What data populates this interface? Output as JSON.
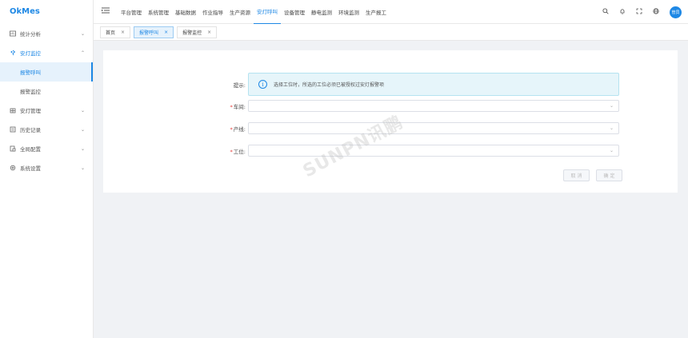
{
  "app": {
    "logo": "OkMes"
  },
  "sidebar": {
    "items": [
      {
        "label": "统计分析",
        "icon": "chart-icon",
        "chev": "⌄"
      },
      {
        "label": "安灯监控",
        "icon": "monitor-icon",
        "chev": "⌃",
        "open": true,
        "children": [
          {
            "label": "报警呼叫",
            "active": true
          },
          {
            "label": "报警监控"
          }
        ]
      },
      {
        "label": "安灯管理",
        "icon": "building-icon",
        "chev": "⌄"
      },
      {
        "label": "历史记录",
        "icon": "history-icon",
        "chev": "⌄"
      },
      {
        "label": "全局配置",
        "icon": "config-icon",
        "chev": "⌄"
      },
      {
        "label": "系统设置",
        "icon": "gear-icon",
        "chev": "⌄"
      }
    ]
  },
  "topnav": {
    "items": [
      "平台管理",
      "系统管理",
      "基础数据",
      "作业指导",
      "生产资源",
      "安灯呼叫",
      "设备管理",
      "静电监测",
      "环境监测",
      "生产报工"
    ],
    "active_index": 5
  },
  "user": {
    "avatar_text": "管员"
  },
  "tabs": [
    {
      "label": "首页",
      "close": "×"
    },
    {
      "label": "报警呼叫",
      "close": "×",
      "active": true
    },
    {
      "label": "报警监控",
      "close": "×"
    }
  ],
  "form": {
    "tip_label": "提示:",
    "tip_text": "选择工位时，所选的工位必须已被授权过安灯报警项",
    "required_mark": "*",
    "fields": [
      {
        "label": "车间:",
        "value": ""
      },
      {
        "label": "产线:",
        "value": ""
      },
      {
        "label": "工位:",
        "value": ""
      }
    ],
    "cancel_label": "取 消",
    "confirm_label": "确 定"
  },
  "watermark": "SUNPN讯鹏",
  "colors": {
    "accent": "#1e88e5",
    "tip_bg": "#e6f5fa",
    "required": "#e53935"
  }
}
